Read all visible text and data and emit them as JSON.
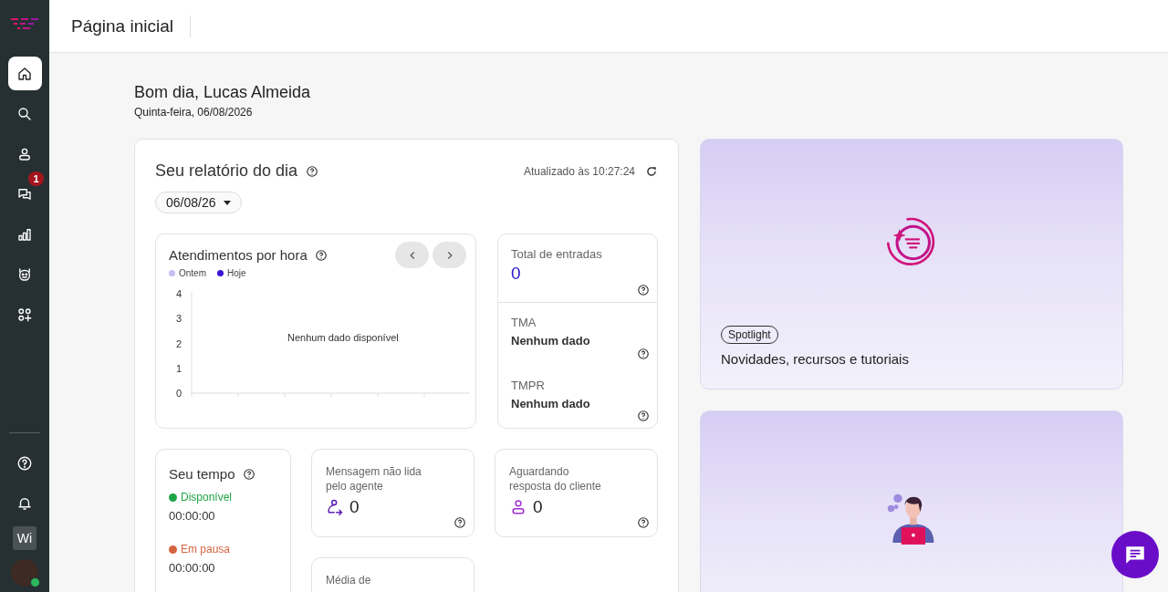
{
  "sidebar": {
    "items": [
      {
        "kind": "home",
        "selected": true
      },
      {
        "kind": "search",
        "selected": false
      },
      {
        "kind": "contacts",
        "selected": false
      },
      {
        "kind": "chats",
        "selected": false,
        "badge": "1"
      },
      {
        "kind": "reports",
        "selected": false
      },
      {
        "kind": "bot",
        "selected": false
      },
      {
        "kind": "apps",
        "selected": false
      }
    ],
    "bottom": [
      {
        "kind": "help"
      },
      {
        "kind": "bell"
      }
    ],
    "workspace": "Wi",
    "avatar": {
      "online": true
    }
  },
  "header": {
    "title": "Página inicial"
  },
  "greeting": {
    "title": "Bom dia, Lucas Almeida",
    "date": "Quinta-feira, 06/08/2026"
  },
  "report": {
    "title": "Seu relatório do dia",
    "updated": "Atualizado às 10:27:24",
    "date_filter": "06/08/26",
    "hourly": {
      "title": "Atendimentos por hora",
      "empty": "Nenhum dado disponível",
      "chart_data": {
        "type": "line",
        "yticks": [
          0,
          1,
          2,
          3,
          4
        ],
        "ylim": [
          0,
          4
        ],
        "series": [
          {
            "name": "Ontem",
            "color": "#c6bdf4"
          },
          {
            "name": "Hoje",
            "color": "#3b14d4"
          }
        ]
      }
    },
    "summary": [
      {
        "kind": "count",
        "label": "Total de entradas",
        "value": "0"
      },
      {
        "kind": "text",
        "label": "TMA",
        "value": "Nenhum dado"
      },
      {
        "kind": "text",
        "label": "TMPR",
        "value": "Nenhum dado"
      }
    ],
    "time": {
      "title": "Seu tempo",
      "statuses": [
        {
          "label": "Disponível",
          "time": "00:00:00",
          "color": "#1ea446"
        },
        {
          "label": "Em pausa",
          "time": "00:00:00",
          "color": "#d4643f"
        }
      ]
    },
    "tiles": [
      {
        "kind": "unread",
        "label": "Mensagem não lida pelo agente",
        "value": "0"
      },
      {
        "kind": "waiting",
        "label": "Aguardando resposta do cliente",
        "value": "0"
      },
      {
        "label": "Média de"
      }
    ]
  },
  "spotlight": {
    "tag": "Spotlight",
    "title": "Novidades, recursos e tutoriais"
  }
}
